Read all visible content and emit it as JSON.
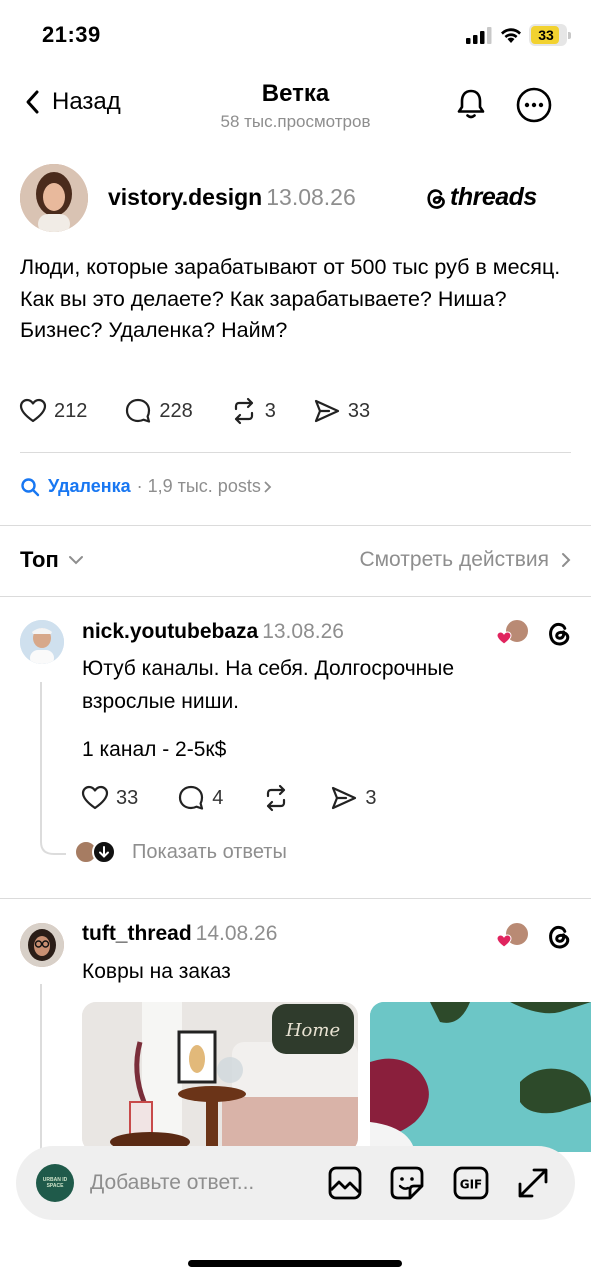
{
  "status_bar": {
    "time": "21:39",
    "battery": "33"
  },
  "header": {
    "back_label": "Назад",
    "title": "Ветка",
    "subtitle": "58 тыс.просмотров"
  },
  "post": {
    "username": "vistory.design",
    "date": "13.08.26",
    "brand": "threads",
    "text": "Люди, которые зарабатывают от 500 тыс руб в месяц. Как вы это делаете? Как зарабатываете? Ниша? Бизнес? Удаленка? Найм?",
    "likes": "212",
    "comments": "228",
    "reposts": "3",
    "shares": "33"
  },
  "topic": {
    "name": "Удаленка",
    "meta": "· 1,9 тыс. posts"
  },
  "sort": {
    "label": "Топ",
    "activity_label": "Смотреть действия"
  },
  "replies": [
    {
      "username": "nick.youtubebaza",
      "date": "13.08.26",
      "text_line1": "Ютуб каналы. На себя. Долгосрочные",
      "text_line2": "взрослые ниши.",
      "text_line3": "1 канал - 2-5к$",
      "likes": "33",
      "comments": "4",
      "shares": "3",
      "show_replies": "Показать ответы"
    },
    {
      "username": "tuft_thread",
      "date": "14.08.26",
      "text": "Ковры на заказ",
      "image1_text": "Home"
    }
  ],
  "composer": {
    "placeholder": "Добавьте ответ...",
    "avatar_text": "URBAN ID SPACE"
  },
  "icons": [
    "chevron-left-icon",
    "bell-icon",
    "more-icon",
    "threads-icon",
    "heart-icon",
    "comment-icon",
    "repost-icon",
    "share-icon",
    "search-icon",
    "chevron-down-icon",
    "chevron-right-icon",
    "image-icon",
    "sticker-icon",
    "gif-icon",
    "expand-icon"
  ],
  "colors": {
    "link": "#1877f2",
    "muted": "#8e8e8e",
    "like": "#e0245e",
    "battery": "#f2d230"
  }
}
